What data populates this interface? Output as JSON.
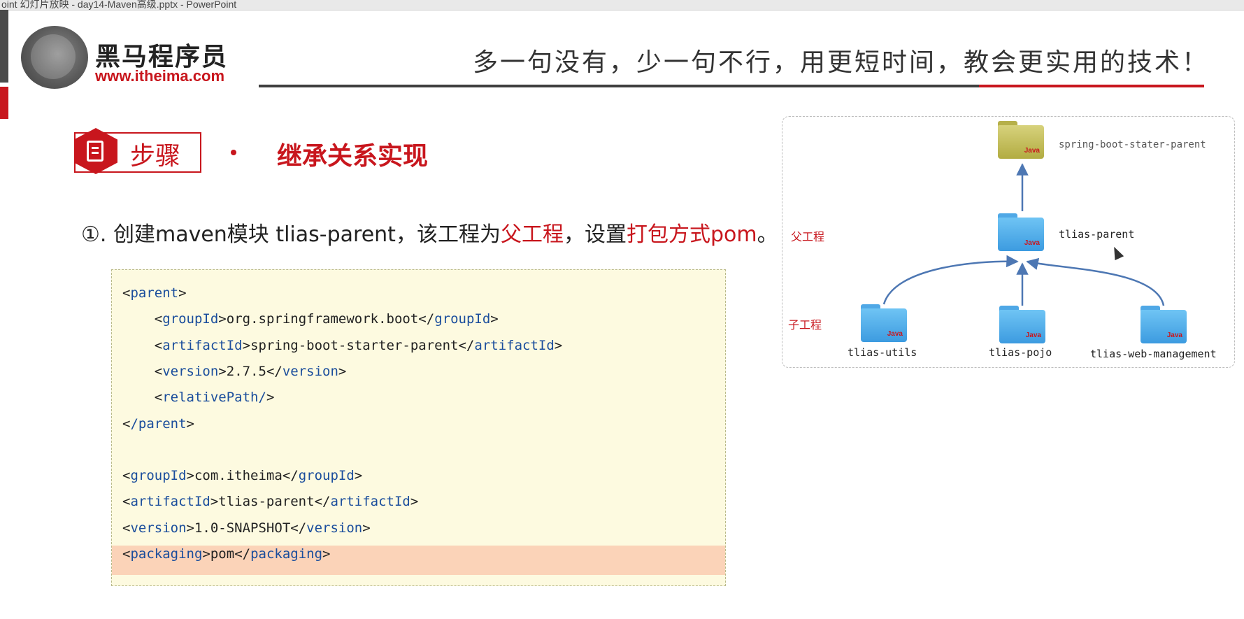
{
  "window": {
    "title": "oint 幻灯片放映 - day14-Maven高级.pptx - PowerPoint"
  },
  "brand": {
    "name": "黑马程序员",
    "url": "www.itheima.com"
  },
  "slogan": "多一句没有，少一句不行，用更短时间，教会更实用的技术！",
  "step": {
    "badge": "步骤",
    "title": "继承关系实现"
  },
  "instruction": {
    "prefix": "①. 创建maven模块 tlias-parent，该工程为",
    "highlight1": "父工程",
    "middle": "，设置",
    "highlight2": "打包方式pom",
    "suffix": "。"
  },
  "code": {
    "lines": [
      {
        "indent": "",
        "open": "parent",
        "text": "",
        "close": ""
      },
      {
        "indent": "    ",
        "open": "groupId",
        "text": "org.springframework.boot",
        "close": "groupId"
      },
      {
        "indent": "    ",
        "open": "artifactId",
        "text": "spring-boot-starter-parent",
        "close": "artifactId"
      },
      {
        "indent": "    ",
        "open": "version",
        "text": "2.7.5",
        "close": "version"
      },
      {
        "indent": "    ",
        "open": "relativePath/",
        "text": "",
        "close": ""
      },
      {
        "indent": "",
        "open": "/parent",
        "text": "",
        "close": ""
      },
      {
        "indent": "",
        "open": "",
        "text": "",
        "close": ""
      },
      {
        "indent": "",
        "open": "groupId",
        "text": "com.itheima",
        "close": "groupId"
      },
      {
        "indent": "",
        "open": "artifactId",
        "text": "tlias-parent",
        "close": "artifactId"
      },
      {
        "indent": "",
        "open": "version",
        "text": "1.0-SNAPSHOT",
        "close": "version"
      },
      {
        "indent": "",
        "open": "packaging",
        "text": "pom",
        "close": "packaging"
      }
    ],
    "highlighted_line": 11
  },
  "diagram": {
    "top": {
      "name": "spring-boot-stater-parent",
      "icon": "java-folder-icon"
    },
    "parent": {
      "name": "tlias-parent",
      "icon": "java-folder-icon"
    },
    "parent_label": "父工程",
    "children_label": "子工程",
    "children": [
      {
        "name": "tlias-utils",
        "icon": "java-folder-icon"
      },
      {
        "name": "tlias-pojo",
        "icon": "java-folder-icon"
      },
      {
        "name": "tlias-web-management",
        "icon": "java-folder-icon"
      }
    ],
    "folder_icon_text": "Java",
    "colors": {
      "child_folder": "#4fa8e6",
      "top_folder": "#c9c363",
      "arrow": "#4d77b3"
    }
  }
}
